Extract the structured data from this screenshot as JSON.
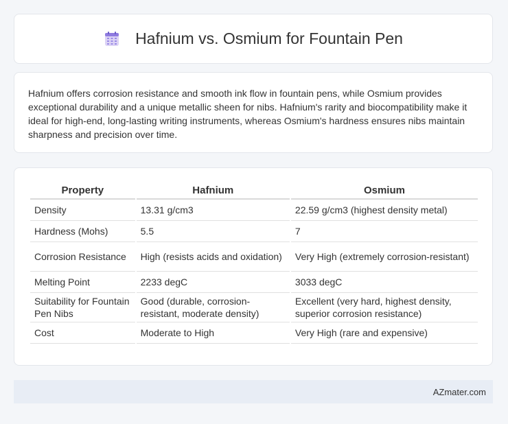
{
  "header": {
    "title": "Hafnium vs. Osmium for Fountain Pen",
    "icon": "calendar-icon"
  },
  "description": "Hafnium offers corrosion resistance and smooth ink flow in fountain pens, while Osmium provides exceptional durability and a unique metallic sheen for nibs. Hafnium's rarity and biocompatibility make it ideal for high-end, long-lasting writing instruments, whereas Osmium's hardness ensures nibs maintain sharpness and precision over time.",
  "table": {
    "headers": [
      "Property",
      "Hafnium",
      "Osmium"
    ],
    "rows": [
      [
        "Density",
        "13.31 g/cm3",
        "22.59 g/cm3 (highest density metal)"
      ],
      [
        "Hardness (Mohs)",
        "5.5",
        "7"
      ],
      [
        "Corrosion Resistance",
        "High (resists acids and oxidation)",
        "Very High (extremely corrosion-resistant)"
      ],
      [
        "Melting Point",
        "2233 degC",
        "3033 degC"
      ],
      [
        "Suitability for Fountain Pen Nibs",
        "Good (durable, corrosion-resistant, moderate density)",
        "Excellent (very hard, highest density, superior corrosion resistance)"
      ],
      [
        "Cost",
        "Moderate to High",
        "Very High (rare and expensive)"
      ]
    ]
  },
  "footer": {
    "brand": "AZmater.com"
  }
}
